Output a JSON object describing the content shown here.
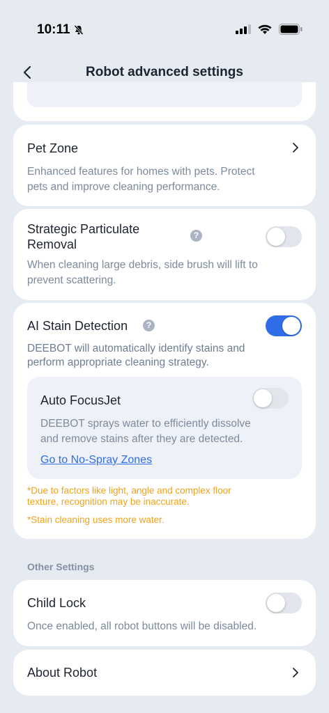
{
  "status": {
    "time": "10:11"
  },
  "nav": {
    "title": "Robot advanced settings"
  },
  "pet_zone": {
    "title": "Pet Zone",
    "description_line1": "Enhanced features for homes with pets. Protect",
    "description_line2": "pets and improve cleaning performance."
  },
  "particulate": {
    "title_line1": "Strategic Particulate",
    "title_line2": "Removal",
    "enabled": false,
    "description_line1": "When cleaning large debris, side brush will lift to",
    "description_line2": "prevent scattering."
  },
  "ai_stain": {
    "title": "AI Stain Detection",
    "enabled": true,
    "description_line1": "DEEBOT will automatically identify stains and",
    "description_line2": "perform appropriate cleaning strategy.",
    "focusjet": {
      "title": "Auto FocusJet",
      "enabled": false,
      "description_line1": "DEEBOT sprays water to efficiently dissolve",
      "description_line2": "and remove stains after they are detected.",
      "link": "Go to No-Spray Zones"
    },
    "note1_line1": "*Due to factors like light, angle and complex floor",
    "note1_line2": "texture, recognition may be inaccurate.",
    "note2": "*Stain cleaning uses more water."
  },
  "other_settings": {
    "label": "Other Settings"
  },
  "child_lock": {
    "title": "Child Lock",
    "enabled": false,
    "description": "Once enabled, all robot buttons will be disabled."
  },
  "about": {
    "title": "About Robot"
  },
  "colors": {
    "accent": "#2f6ee8",
    "warning": "#f0a31c",
    "background": "#e6eaf1"
  }
}
